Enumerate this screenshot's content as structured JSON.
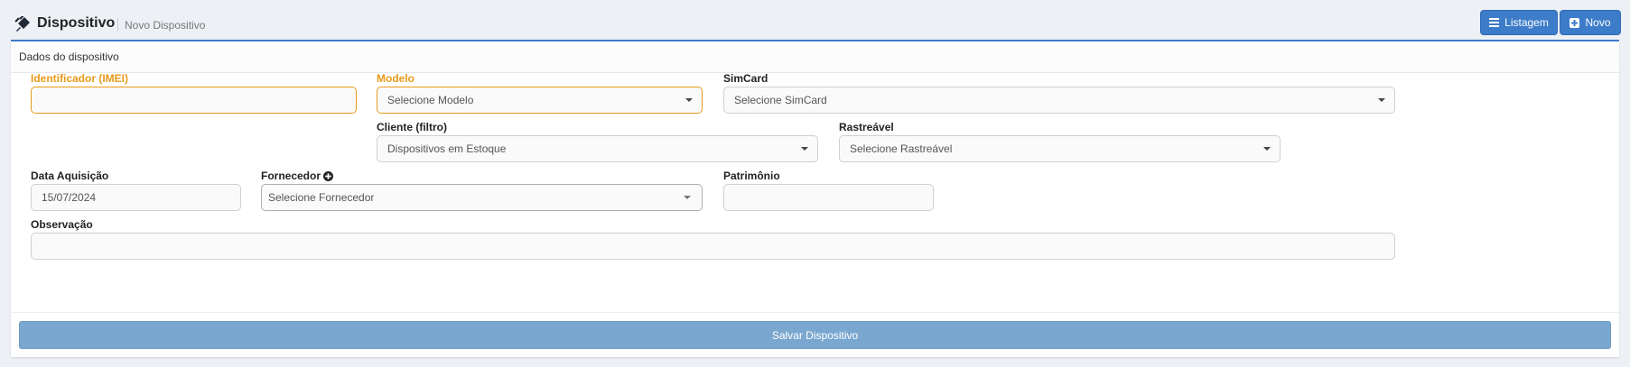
{
  "header": {
    "icon": "plug-icon",
    "title": "Dispositivo",
    "subtitle": "Novo Dispositivo",
    "buttons": {
      "list_label": "Listagem",
      "list_icon": "bars-icon",
      "new_label": "Novo",
      "new_icon": "plus-square-icon"
    }
  },
  "card": {
    "title": "Dados do dispositivo"
  },
  "form": {
    "imei": {
      "label": "Identificador (IMEI)",
      "value": ""
    },
    "modelo": {
      "label": "Modelo",
      "value": "Selecione Modelo"
    },
    "simcard": {
      "label": "SimCard",
      "value": "Selecione SimCard"
    },
    "cliente": {
      "label": "Cliente (filtro)",
      "value": "Dispositivos em Estoque"
    },
    "rastreavel": {
      "label": "Rastreável",
      "value": "Selecione Rastreável"
    },
    "data_aquisicao": {
      "label": "Data Aquisição",
      "value": "15/07/2024"
    },
    "fornecedor": {
      "label": "Fornecedor",
      "value": "Selecione Fornecedor",
      "add_icon": "plus-circle-icon"
    },
    "patrimonio": {
      "label": "Patrimônio",
      "value": ""
    },
    "observacao": {
      "label": "Observação",
      "value": ""
    }
  },
  "actions": {
    "save_label": "Salvar Dispositivo"
  },
  "colors": {
    "primary": "#3d7cc9",
    "required": "#e89a1a",
    "save_button": "#7aa7cf",
    "background": "#edf0f4"
  }
}
